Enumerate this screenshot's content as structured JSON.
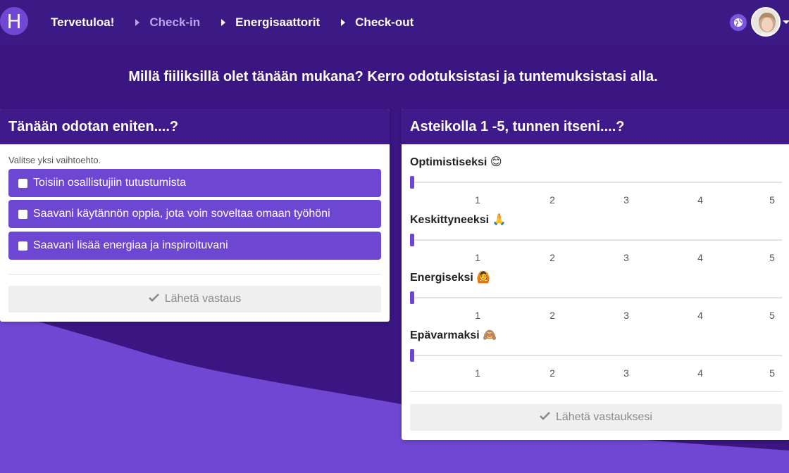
{
  "nav": {
    "logo": "H",
    "items": [
      {
        "label": "Tervetuloa!"
      },
      {
        "label": "Check-in"
      },
      {
        "label": "Energisaattorit"
      },
      {
        "label": "Check-out"
      }
    ]
  },
  "headline": "Millä fiiliksillä olet tänään mukana? Kerro odotuksistasi ja tuntemuksistasi alla.",
  "left_panel": {
    "title": "Tänään odotan eniten....?",
    "helper": "Valitse yksi vaihtoehto.",
    "options": [
      {
        "label": "Toisiin osallistujiin tutustumista"
      },
      {
        "label": "Saavani käytännön oppia, jota voin soveltaa omaan työhöni"
      },
      {
        "label": "Saavani lisää energiaa ja inspiroituvani"
      }
    ],
    "submit_label": "Lähetä vastaus"
  },
  "right_panel": {
    "title": "Asteikolla 1 -5, tunnen itseni....?",
    "scale": [
      "1",
      "2",
      "3",
      "4",
      "5"
    ],
    "questions": [
      {
        "label": "Optimistiseksi 😊",
        "value": 0
      },
      {
        "label": "Keskittyneeksi 🙏",
        "value": 0
      },
      {
        "label": "Energiseksi 🙆",
        "value": 0
      },
      {
        "label": "Epävarmaksi 🙈",
        "value": 0
      }
    ],
    "submit_label": "Lähetä vastauksesi"
  },
  "colors": {
    "primary": "#6d46d1",
    "dark": "#3c1a86",
    "background": "#6f47d3"
  }
}
